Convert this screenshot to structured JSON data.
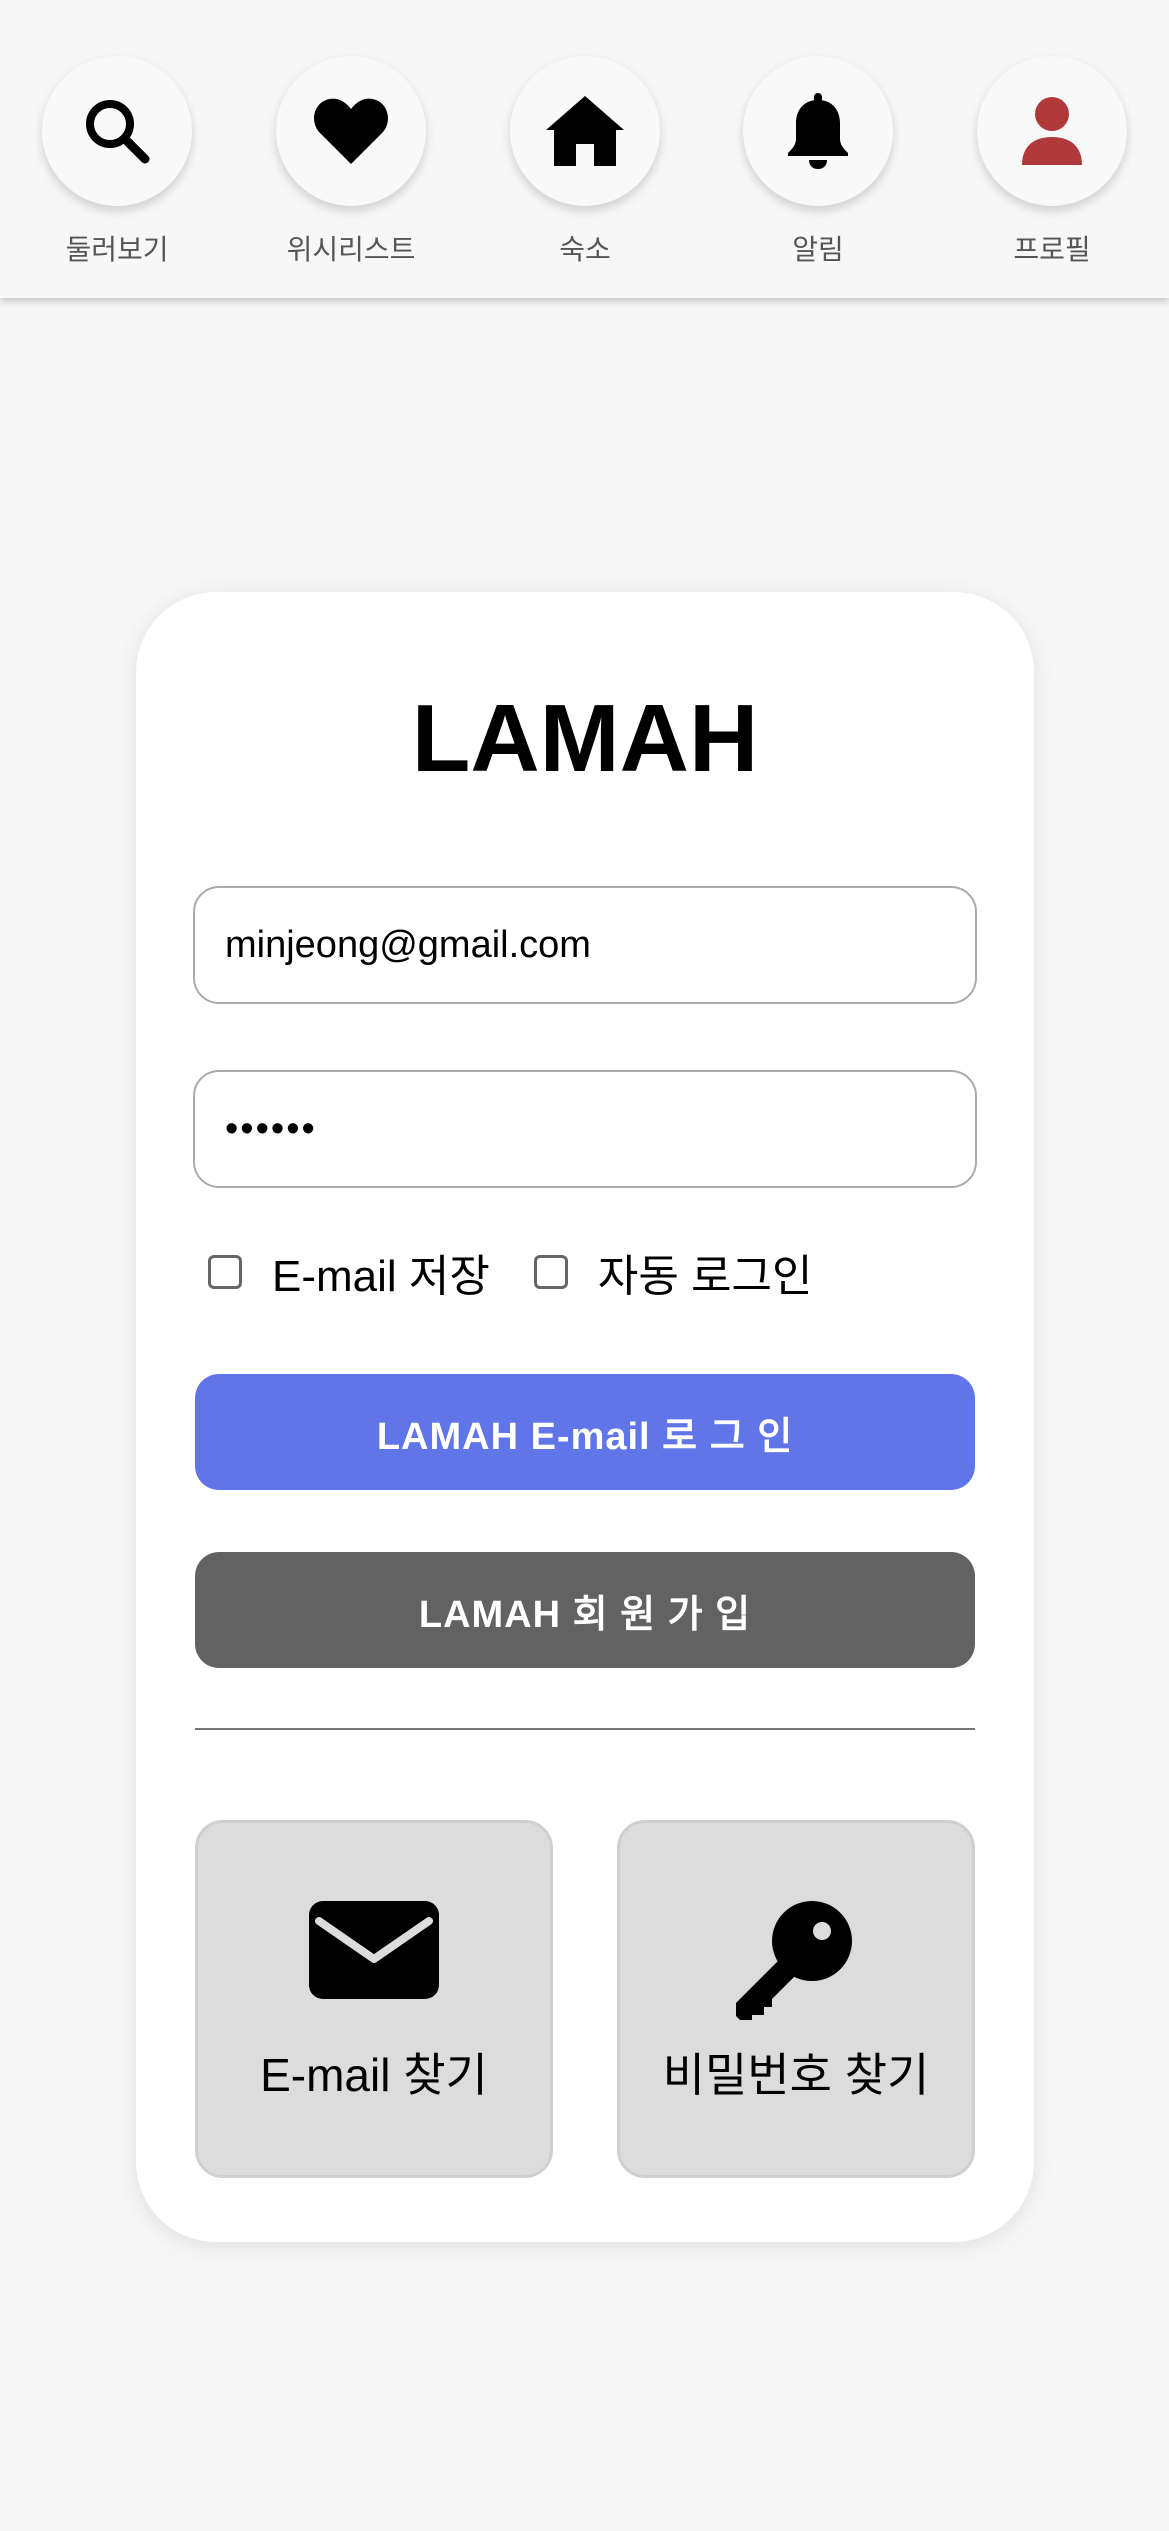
{
  "nav": {
    "items": [
      {
        "label": "둘러보기",
        "icon": "search-icon"
      },
      {
        "label": "위시리스트",
        "icon": "heart-icon"
      },
      {
        "label": "숙소",
        "icon": "home-icon"
      },
      {
        "label": "알림",
        "icon": "bell-icon"
      },
      {
        "label": "프로필",
        "icon": "user-icon",
        "color": "#b03a3a"
      }
    ]
  },
  "login": {
    "logo": "LAMAH",
    "email_value": "minjeong@gmail.com",
    "password_value": "••••••",
    "save_email_label": "E-mail 저장",
    "auto_login_label": "자동 로그인",
    "login_button": "LAMAH E-mail 로 그 인",
    "signup_button": "LAMAH 회 원 가 입",
    "find_email_label": "E-mail 찾기",
    "find_password_label": "비밀번호 찾기"
  },
  "colors": {
    "login_button": "#6076e8",
    "signup_button": "#626262",
    "profile_icon": "#b03a3a"
  }
}
